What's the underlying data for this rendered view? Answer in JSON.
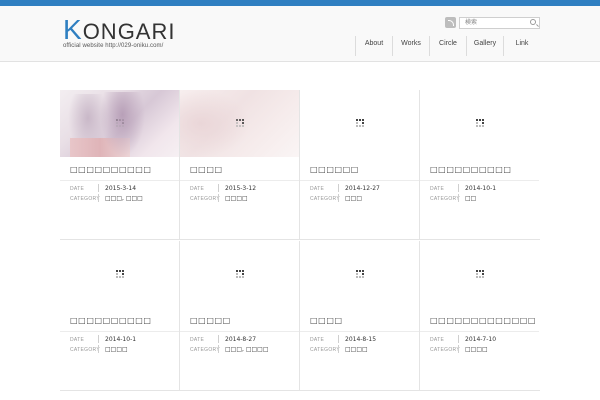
{
  "brand": {
    "logo_initial": "K",
    "logo_rest": "ONGARI",
    "tagline": "official website http://029-oniku.com/",
    "accent_color": "#2f7fc1"
  },
  "header": {
    "rss_icon": "rss-icon",
    "search": {
      "placeholder": "検索",
      "icon": "search-icon"
    },
    "nav": [
      {
        "label": "About"
      },
      {
        "label": "Works"
      },
      {
        "label": "Circle"
      },
      {
        "label": "Gallery"
      },
      {
        "label": "Link"
      }
    ]
  },
  "meta_labels": {
    "date": "DATE",
    "category": "CATEGORY"
  },
  "posts": [
    {
      "title": "□□□□□□□□□□",
      "date": "2015-3-14",
      "category": "□□□, □□□",
      "thumbnail": "illustration"
    },
    {
      "title": "□□□□",
      "date": "2015-3-12",
      "category": "□□□□",
      "thumbnail": "illustration"
    },
    {
      "title": "□□□□□□",
      "date": "2014-12-27",
      "category": "□□□",
      "thumbnail": "loading"
    },
    {
      "title": "□□□□□□□□□□",
      "date": "2014-10-1",
      "category": "□□",
      "thumbnail": "loading"
    },
    {
      "title": "□□□□□□□□□□",
      "date": "2014-10-1",
      "category": "□□□□",
      "thumbnail": "loading"
    },
    {
      "title": "□□□□□",
      "date": "2014-8-27",
      "category": "□□□, □□□□",
      "thumbnail": "loading"
    },
    {
      "title": "□□□□",
      "date": "2014-8-15",
      "category": "□□□□",
      "thumbnail": "loading"
    },
    {
      "title": "□□□□□□□□□□□□□",
      "date": "2014-7-10",
      "category": "□□□□",
      "thumbnail": "loading"
    }
  ]
}
